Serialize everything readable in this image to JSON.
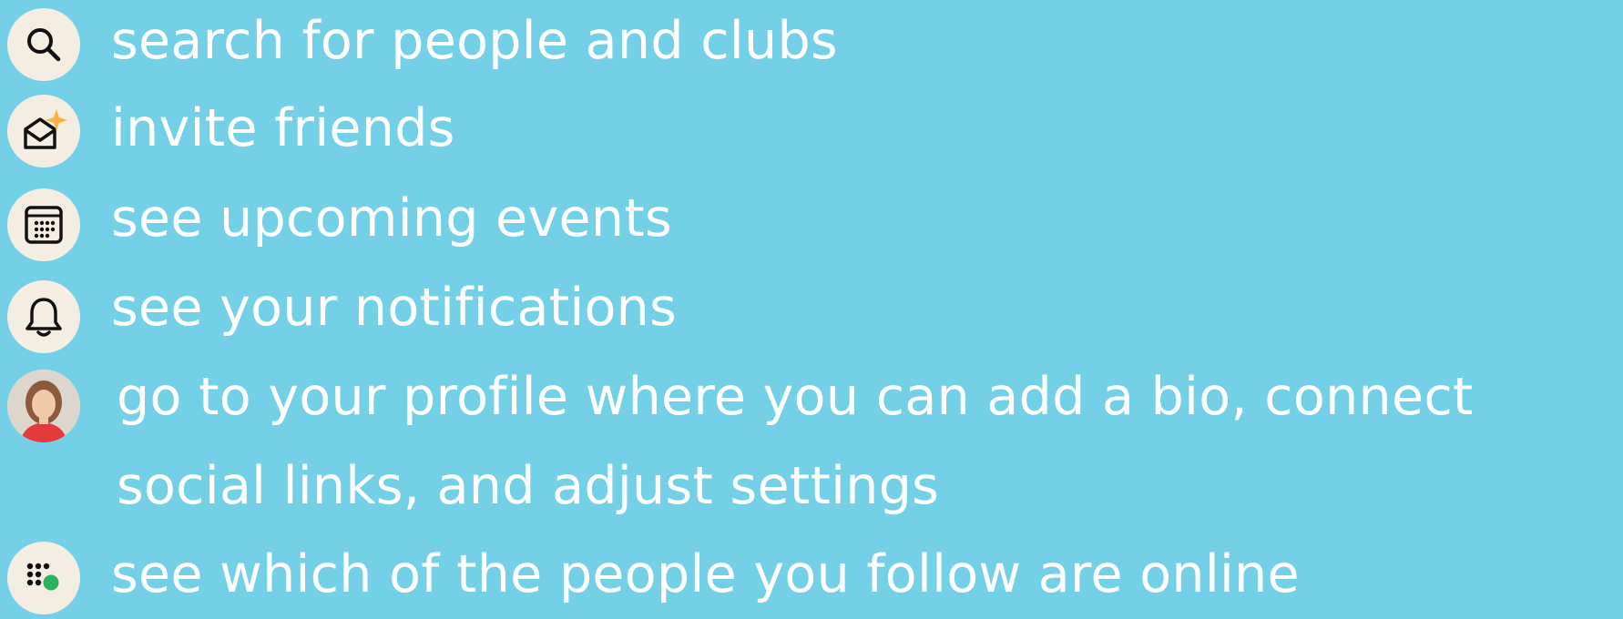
{
  "items": [
    {
      "icon": "search-icon",
      "label": "search for people and clubs"
    },
    {
      "icon": "invite-envelope-sparkle-icon",
      "label": "invite friends"
    },
    {
      "icon": "calendar-icon",
      "label": "see upcoming events"
    },
    {
      "icon": "bell-icon",
      "label": "see your notifications"
    },
    {
      "icon": "profile-avatar",
      "label": "go to your profile where you can add a bio, connect social links, and adjust settings"
    },
    {
      "icon": "online-grid-dot-icon",
      "label": "see which of the people you follow are online"
    }
  ],
  "colors": {
    "background": "#74d0e6",
    "icon_circle": "#f4eee2",
    "text": "#ffffff",
    "sparkle": "#f6b24a",
    "online_dot": "#2bb05b"
  }
}
